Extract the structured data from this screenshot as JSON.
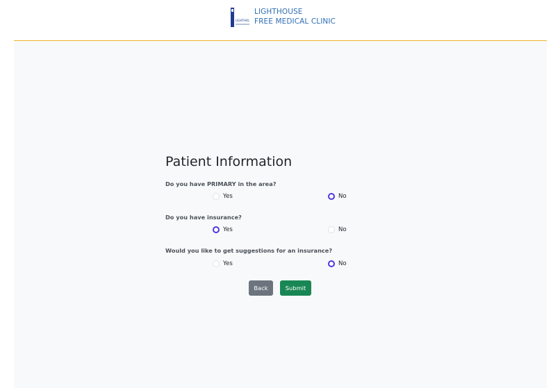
{
  "header": {
    "logo_text": "LIGHTHOUSE",
    "brand_line1": "LIGHTHOUSE",
    "brand_line2": "FREE MEDICAL CLINIC"
  },
  "form": {
    "title": "Patient Information",
    "questions": [
      {
        "label": "Do you have PRIMARY in the area?",
        "yes_label": "Yes",
        "no_label": "No",
        "selected": "No"
      },
      {
        "label": "Do you have insurance?",
        "yes_label": "Yes",
        "no_label": "No",
        "selected": "Yes"
      },
      {
        "label": "Would you like to get suggestions for an insurance?",
        "yes_label": "Yes",
        "no_label": "No",
        "selected": "No"
      }
    ],
    "back_label": "Back",
    "submit_label": "Submit"
  },
  "colors": {
    "accent_line": "#f0b429",
    "brand": "#2f6eb5",
    "radio_checked": "#4f36e0",
    "back_button": "#6c757d",
    "submit_button": "#198754"
  }
}
